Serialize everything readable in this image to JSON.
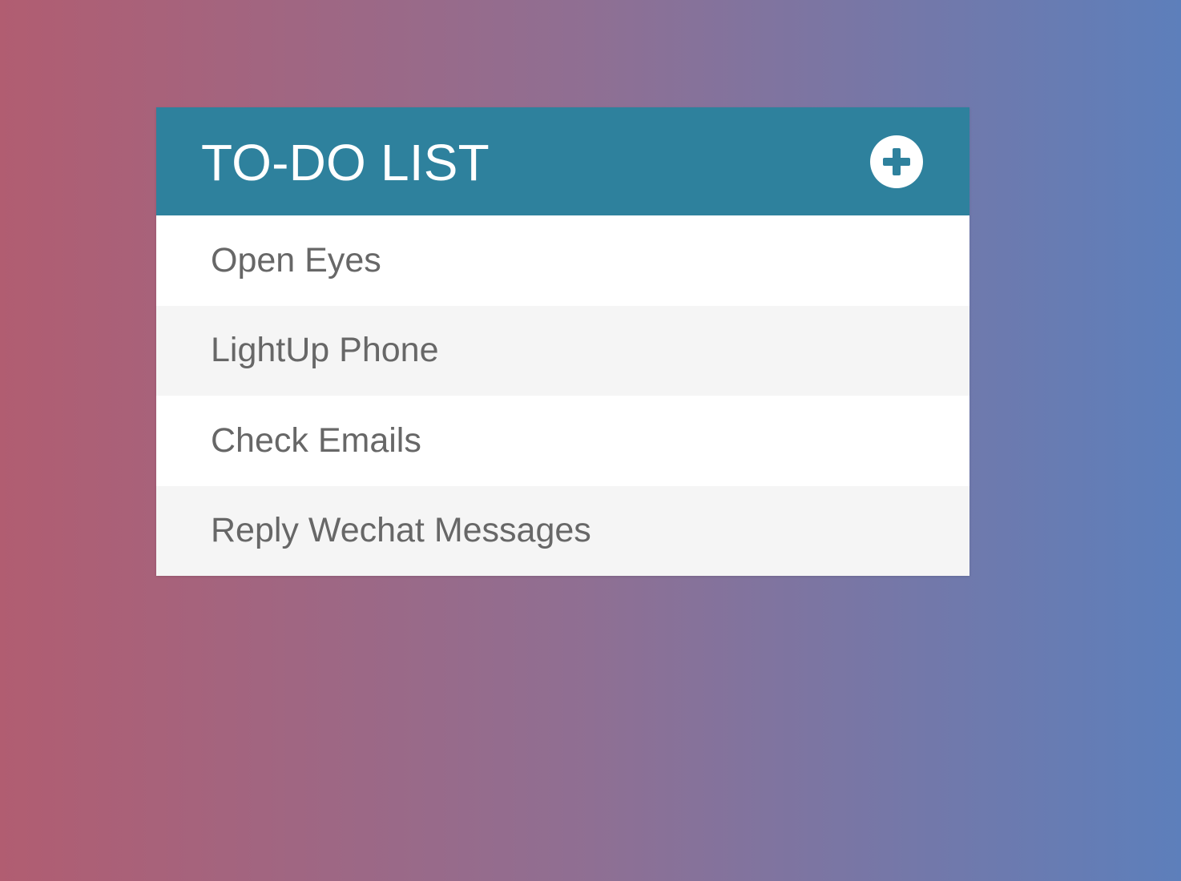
{
  "theme": {
    "header_color": "#2e819d",
    "odd_row_color": "#ffffff",
    "even_row_color": "#f5f5f5",
    "text_color": "#676767",
    "background_gradient": [
      "#b15d71",
      "#8f6f93",
      "#5d7fbb"
    ]
  },
  "todo": {
    "title": "TO-DO LIST",
    "add_icon": "plus-circle-icon",
    "items": [
      {
        "label": "Open Eyes"
      },
      {
        "label": "LightUp Phone"
      },
      {
        "label": "Check Emails"
      },
      {
        "label": "Reply Wechat Messages"
      }
    ]
  }
}
